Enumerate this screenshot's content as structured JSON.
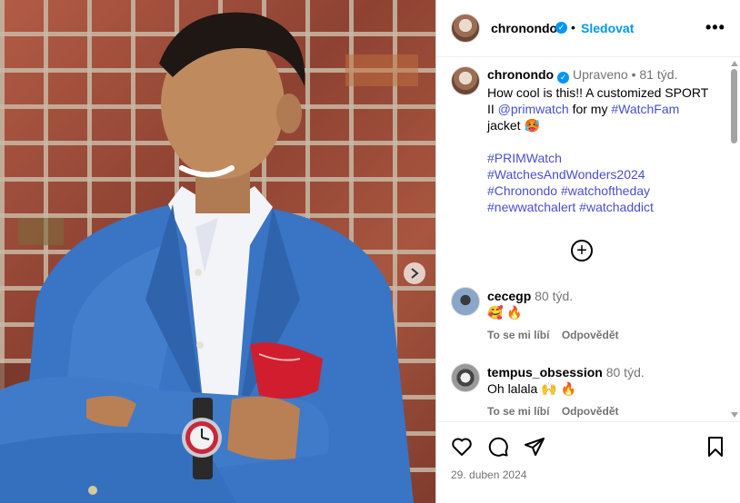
{
  "post": {
    "username": "chronondo",
    "follow_label": "Sledovat",
    "separator": "•",
    "more_label": "•••",
    "date": "29. duben 2024"
  },
  "caption": {
    "username": "chronondo",
    "edited": "Upraveno",
    "age": "81 týd.",
    "text_before": "How cool is this!! A customized SPORT II ",
    "mention": "@primwatch",
    "text_mid": " for my ",
    "tag_inline": "#WatchFam",
    "text_after": " jacket 🥵",
    "hashtags": [
      "#PRIMWatch",
      "#WatchesAndWonders2024",
      "#Chronondo",
      "#watchoftheday",
      "#newwatchalert",
      "#watchaddict"
    ]
  },
  "comments": [
    {
      "username": "cecegp",
      "age": "80 týd.",
      "text": "🥰 🔥",
      "like_label": "To se mi líbí",
      "reply_label": "Odpovědět"
    },
    {
      "username": "tempus_obsession",
      "age": "80 týd.",
      "text": "Oh lalala 🙌 🔥",
      "like_label": "To se mi líbí",
      "reply_label": "Odpovědět"
    }
  ],
  "icons": {
    "verified": "verified-badge-icon",
    "next": "chevron-right-icon",
    "like": "heart-icon",
    "comment": "comment-icon",
    "share": "share-icon",
    "save": "bookmark-icon",
    "load_more": "plus-circle-icon"
  },
  "colors": {
    "accent": "#0095f6",
    "link": "#4a4fcf",
    "muted": "#737373"
  }
}
